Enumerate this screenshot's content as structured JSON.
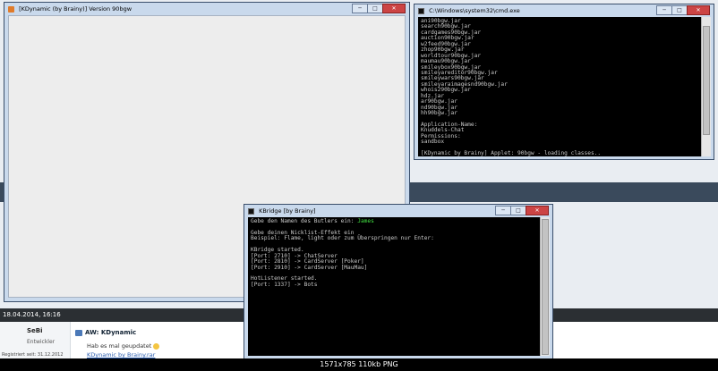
{
  "forum": {
    "date": "18.04.2014, 16:16",
    "user": {
      "name": "SeBi",
      "role": "Entwickler",
      "registered": "Registriert seit: 31.12.2012"
    },
    "post": {
      "title": "AW: KDynamic",
      "text": "Hab es mal geupdatet",
      "link": "KDynamic by Brainy.rar"
    }
  },
  "java_window": {
    "title": "[KDynamic (by Brainy)] Version 90bgw"
  },
  "cmd_window": {
    "title": "C:\\Windows\\system32\\cmd.exe",
    "lines": [
      "ani90bgw.jar",
      "search90bgw.jar",
      "cardgames90bgw.jar",
      "auction90bgw.jar",
      "w2feed90bgw.jar",
      "zhop90bgw.jar",
      "worldtour90bgw.jar",
      "maumau90bgw.jar",
      "smileybox90bgw.jar",
      "smileyareditor90bgw.jar",
      "smileywars90bgw.jar",
      "smileyaraimagesnd90bgw.jar",
      "whois290bgw.jar",
      "hdz.jar",
      "ar90bgw.jar",
      "nd90bgw.jar",
      "hh90bgw.jar",
      "",
      "Application-Name:",
      "Knuddels-Chat",
      "Permissions:",
      "sandbox",
      "",
      "[KDynamic by Brainy] Applet: 90bgw - loading classes.."
    ]
  },
  "kbridge_window": {
    "title": "KBridge [by Brainy]",
    "prompt": "Gebe den Namen des Butlers ein: ",
    "butler": "James",
    "lines": [
      "",
      "Gebe deinen Nicklist-Effekt ein",
      "Beispiel: Flame, light oder zum Überspringen nur Enter:",
      "",
      "KBridge started.",
      "[Port: 2710] -> ChatServer",
      "[Port: 2810] -> CardServer [Poker]",
      "[Port: 2910] -> CardServer [MauMau]",
      "",
      "HotListener started.",
      "[Port: 1337] -> Bots"
    ]
  },
  "window_controls": {
    "minimize": "─",
    "maximize": "□",
    "close": "✕"
  },
  "footer": {
    "caption": "1571x785  110kb  PNG"
  },
  "colors": {
    "console_bg": "#000000",
    "console_fg": "#c8c8c8",
    "highlight": "#42e042",
    "titlebar": "#c9d9ec"
  }
}
